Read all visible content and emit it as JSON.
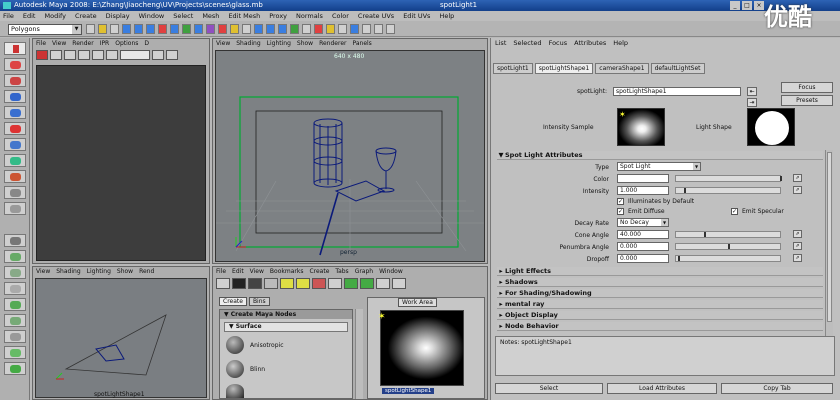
{
  "window": {
    "title": "Autodesk Maya 2008: E:\\Zhang\\Jiaocheng\\UV\\Projects\\scenes\\glass.mb",
    "context": "spotLight1",
    "controls": [
      "_",
      "□",
      "×"
    ]
  },
  "menubar": [
    "File",
    "Edit",
    "Modify",
    "Create",
    "Display",
    "Window",
    "Select",
    "Mesh",
    "Edit Mesh",
    "Proxy",
    "Normals",
    "Color",
    "Create UVs",
    "Edit UVs",
    "Help"
  ],
  "shelf": {
    "mode": "Polygons"
  },
  "topleft_panel": {
    "menu": [
      "File",
      "View",
      "Render",
      "IPR",
      "Options",
      "D"
    ]
  },
  "perspective_panel": {
    "menu": [
      "View",
      "Shading",
      "Lighting",
      "Show",
      "Renderer",
      "Panels"
    ],
    "resolution": "640 x 480",
    "camera": "persp"
  },
  "bottomleft_panel": {
    "menu": [
      "View",
      "Shading",
      "Lighting",
      "Show",
      "Rend"
    ],
    "label": "spotLightShape1"
  },
  "hypershade": {
    "menu": [
      "File",
      "Edit",
      "View",
      "Bookmarks",
      "Create",
      "Tabs",
      "Graph",
      "Window"
    ],
    "tabs": [
      "Create",
      "Bins"
    ],
    "create_header": "Create Maya Nodes",
    "surface_header": "Surface",
    "nodes": [
      "Anisotropic",
      "Blinn"
    ],
    "work_area_label": "Work Area",
    "swatch_label": "spotLightShape1"
  },
  "attribute_editor": {
    "menu": [
      "List",
      "Selected",
      "Focus",
      "Attributes",
      "Help"
    ],
    "tabs": [
      "spotLight1",
      "spotLightShape1",
      "cameraShape1",
      "defaultLightSet"
    ],
    "node_label": "spotLight:",
    "node_name": "spotLightShape1",
    "focus_label": "Focus",
    "presets_label": "Presets",
    "intensity_sample_label": "Intensity Sample",
    "light_shape_label": "Light Shape",
    "section_title": "Spot Light Attributes",
    "type_label": "Type",
    "type_value": "Spot Light",
    "color_label": "Color",
    "intensity_label": "Intensity",
    "intensity_value": "1.000",
    "illum_default_label": "Illuminates by Default",
    "emit_diffuse_label": "Emit Diffuse",
    "emit_specular_label": "Emit Specular",
    "decay_label": "Decay Rate",
    "decay_value": "No Decay",
    "cone_label": "Cone Angle",
    "cone_value": "40.000",
    "penumbra_label": "Penumbra Angle",
    "penumbra_value": "0.000",
    "dropoff_label": "Dropoff",
    "dropoff_value": "0.000",
    "collapsed_sections": [
      "Light Effects",
      "Shadows",
      "For Shading/Shadowing",
      "mental ray",
      "Object Display",
      "Node Behavior"
    ],
    "notes_label": "Notes:  spotLightShape1",
    "bottom_buttons": [
      "Select",
      "Load Attributes",
      "Copy Tab"
    ]
  },
  "overlay_logo": "优酷"
}
